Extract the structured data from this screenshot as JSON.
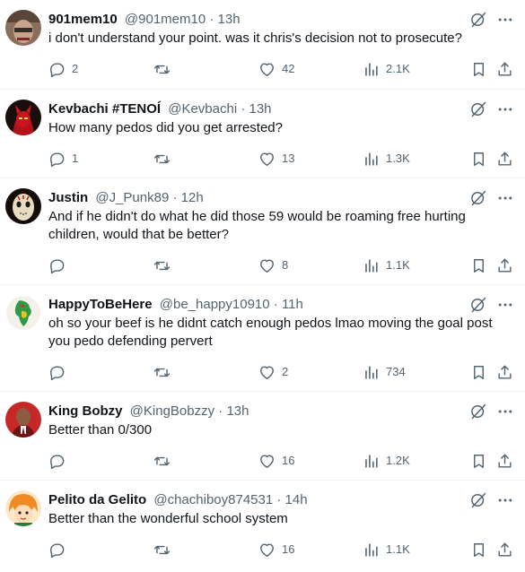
{
  "icons": {
    "reply": "reply-icon",
    "retweet": "retweet-icon",
    "like": "heart-icon",
    "views": "views-chart-icon",
    "bookmark": "bookmark-icon",
    "share": "share-icon",
    "grok": "grok-icon",
    "more": "more-icon"
  },
  "colors": {
    "text": "#0f1419",
    "secondary": "#536471",
    "divider": "#eff3f4"
  },
  "tweets": [
    {
      "name": "901mem10",
      "handle": "@901mem10",
      "dot": "·",
      "time": "13h",
      "lines": [
        "i don't understand your point. was it chris's decision not to prosecute?"
      ],
      "replies": "2",
      "retweets": "",
      "likes": "42",
      "views": "2.1K"
    },
    {
      "name": "Kevbachi #TENOÍ",
      "handle": "@Kevbachi",
      "dot": "·",
      "time": "13h",
      "lines": [
        "How many pedos did you get arrested?"
      ],
      "replies": "1",
      "retweets": "",
      "likes": "13",
      "views": "1.3K"
    },
    {
      "name": "Justin",
      "handle": "@J_Punk89",
      "dot": "·",
      "time": "12h",
      "lines": [
        "And if he didn't do what he did those 59 would be roaming free hurting",
        "children, would that be better?"
      ],
      "replies": "",
      "retweets": "",
      "likes": "8",
      "views": "1.1K"
    },
    {
      "name": "HappyToBeHere",
      "handle": "@be_happy10910",
      "dot": "·",
      "time": "11h",
      "lines": [
        "oh so your beef is he didnt catch enough pedos lmao moving the goal post",
        "you pedo defending pervert"
      ],
      "replies": "",
      "retweets": "",
      "likes": "2",
      "views": "734"
    },
    {
      "name": "King Bobzy",
      "handle": "@KingBobzzy",
      "dot": "·",
      "time": "13h",
      "lines": [
        "Better than 0/300"
      ],
      "replies": "",
      "retweets": "",
      "likes": "16",
      "views": "1.2K"
    },
    {
      "name": "Pelito da Gelito",
      "handle": "@chachiboy874531",
      "dot": "·",
      "time": "14h",
      "lines": [
        "Better than the wonderful school system"
      ],
      "replies": "",
      "retweets": "",
      "likes": "16",
      "views": "1.1K"
    }
  ]
}
